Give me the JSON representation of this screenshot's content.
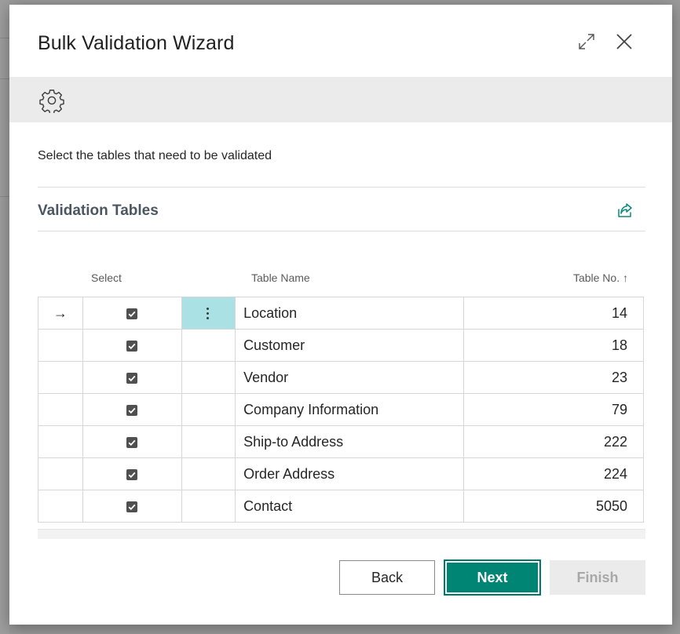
{
  "dialog": {
    "title": "Bulk Validation Wizard"
  },
  "instruction": "Select the tables that need to be validated",
  "section": {
    "title": "Validation Tables"
  },
  "columns": {
    "select": "Select",
    "table_name": "Table Name",
    "table_no": "Table No. ↑"
  },
  "rows": [
    {
      "name": "Location",
      "no": "14",
      "selected": true,
      "current": true
    },
    {
      "name": "Customer",
      "no": "18",
      "selected": true,
      "current": false
    },
    {
      "name": "Vendor",
      "no": "23",
      "selected": true,
      "current": false
    },
    {
      "name": "Company Information",
      "no": "79",
      "selected": true,
      "current": false
    },
    {
      "name": "Ship-to Address",
      "no": "222",
      "selected": true,
      "current": false
    },
    {
      "name": "Order Address",
      "no": "224",
      "selected": true,
      "current": false
    },
    {
      "name": "Contact",
      "no": "5050",
      "selected": true,
      "current": false
    }
  ],
  "row_indicator": "→",
  "buttons": {
    "back": "Back",
    "next": "Next",
    "finish": "Finish"
  },
  "colors": {
    "accent": "#008575",
    "active_cell": "#a9e1e4",
    "disabled_button": "#ebebeb"
  },
  "icons": {
    "expand": "expand-icon",
    "close": "close-icon",
    "settings": "gear-icon",
    "share": "share-icon",
    "row_menu": "more-vertical-icon",
    "checkbox": "checkbox-checked-icon"
  }
}
